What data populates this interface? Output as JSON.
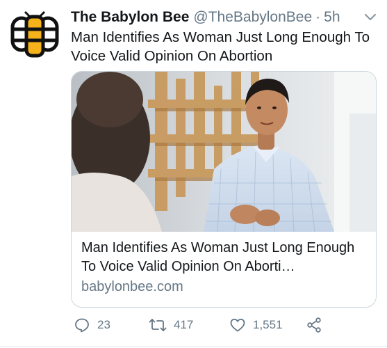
{
  "tweet": {
    "display_name": "The Babylon Bee",
    "handle": "@TheBabylonBee",
    "separator": "·",
    "time": "5h",
    "text": "Man Identifies As Woman Just Long Enough To Voice Valid Opinion On Abortion",
    "avatar_icon": "bee-logo-icon",
    "menu_icon": "chevron-down-icon"
  },
  "card": {
    "image": "photo-man-talking-to-woman",
    "title": "Man Identifies As Woman Just Long Enough To Voice Valid Opinion On Aborti…",
    "domain": "babylonbee.com"
  },
  "actions": {
    "reply_count": "23",
    "retweet_count": "417",
    "like_count": "1,551",
    "reply_icon": "reply-icon",
    "retweet_icon": "retweet-icon",
    "like_icon": "heart-icon",
    "share_icon": "share-icon"
  },
  "colors": {
    "text": "#14171a",
    "secondary": "#657786",
    "border": "#ccd6dd",
    "logo_yellow": "#f5b21b"
  }
}
